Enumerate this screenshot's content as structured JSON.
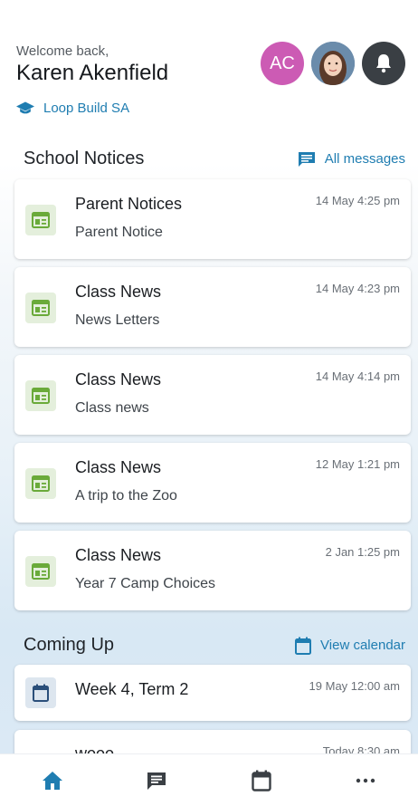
{
  "header": {
    "welcome": "Welcome back,",
    "user_name": "Karen Akenfield",
    "school_name": "Loop Build SA",
    "avatar_initials": "AC"
  },
  "notices": {
    "title": "School Notices",
    "link_label": "All messages",
    "items": [
      {
        "title": "Parent Notices",
        "subtitle": "Parent Notice",
        "time": "14 May 4:25 pm",
        "icon": "newspaper-icon"
      },
      {
        "title": "Class News",
        "subtitle": "News Letters",
        "time": "14 May 4:23 pm",
        "icon": "newspaper-icon"
      },
      {
        "title": "Class News",
        "subtitle": "Class news",
        "time": "14 May 4:14 pm",
        "icon": "newspaper-icon"
      },
      {
        "title": "Class News",
        "subtitle": "A trip to the Zoo",
        "time": "12 May 1:21 pm",
        "icon": "newspaper-icon"
      },
      {
        "title": "Class News",
        "subtitle": "Year 7 Camp Choices",
        "time": "2 Jan 1:25 pm",
        "icon": "newspaper-icon"
      }
    ]
  },
  "coming_up": {
    "title": "Coming Up",
    "link_label": "View calendar",
    "items": [
      {
        "title": "Week 4, Term 2",
        "time": "19 May 12:00 am"
      },
      {
        "title": "wooo",
        "time": "Today 8:30 am"
      }
    ]
  },
  "nav": {
    "items": [
      "home-icon",
      "messages-icon",
      "calendar-icon",
      "more-icon"
    ]
  },
  "colors": {
    "accent": "#1f7db1",
    "avatar_bg": "#cc5bb4",
    "notice_icon": "#6aaa3a",
    "notice_icon_bg": "#e4efdc"
  }
}
